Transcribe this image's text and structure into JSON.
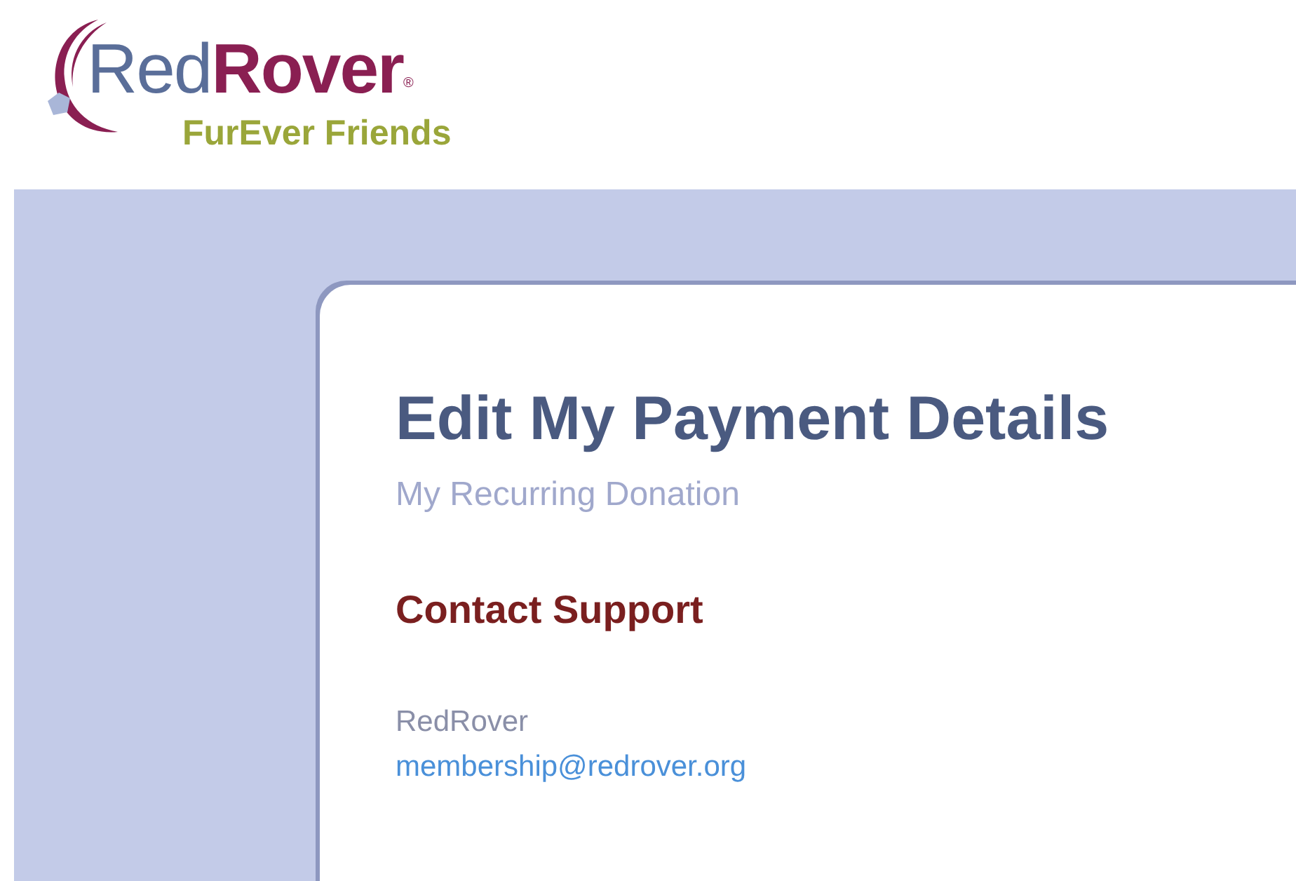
{
  "brand": {
    "first": "Red",
    "second": "Rover",
    "mark": "®",
    "tagline": "FurEver Friends"
  },
  "card": {
    "title": "Edit My Payment Details",
    "subtitle": "My Recurring Donation",
    "section_title": "Contact Support",
    "org_name": "RedRover",
    "email": "membership@redrover.org"
  }
}
